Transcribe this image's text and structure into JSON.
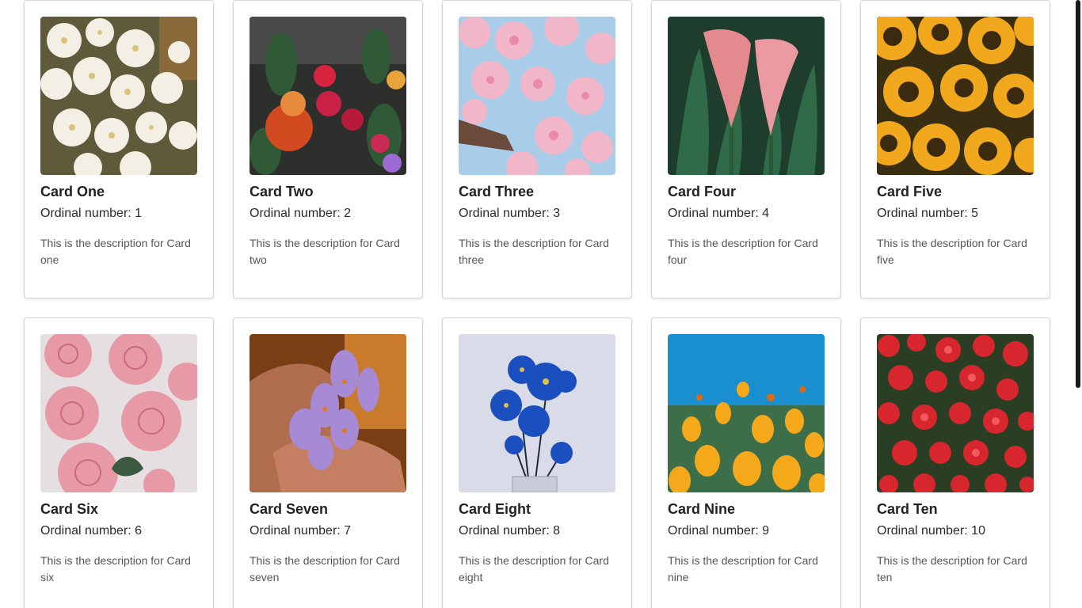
{
  "cards": [
    {
      "title": "Card One",
      "ordinal": "Ordinal number: 1",
      "description": "This is the description for Card one",
      "image_icon": "white-daisy-flowers-image"
    },
    {
      "title": "Card Two",
      "ordinal": "Ordinal number: 2",
      "description": "This is the description for Card two",
      "image_icon": "mixed-bouquet-flowers-image"
    },
    {
      "title": "Card Three",
      "ordinal": "Ordinal number: 3",
      "description": "This is the description for Card three",
      "image_icon": "cherry-blossom-image"
    },
    {
      "title": "Card Four",
      "ordinal": "Ordinal number: 4",
      "description": "This is the description for Card four",
      "image_icon": "calla-lily-image"
    },
    {
      "title": "Card Five",
      "ordinal": "Ordinal number: 5",
      "description": "This is the description for Card five",
      "image_icon": "sunflowers-image"
    },
    {
      "title": "Card Six",
      "ordinal": "Ordinal number: 6",
      "description": "This is the description for Card six",
      "image_icon": "pink-roses-image"
    },
    {
      "title": "Card Seven",
      "ordinal": "Ordinal number: 7",
      "description": "This is the description for Card seven",
      "image_icon": "crocus-in-hand-image"
    },
    {
      "title": "Card Eight",
      "ordinal": "Ordinal number: 8",
      "description": "This is the description for Card eight",
      "image_icon": "blue-daisies-vase-image"
    },
    {
      "title": "Card Nine",
      "ordinal": "Ordinal number: 9",
      "description": "This is the description for Card nine",
      "image_icon": "yellow-poppies-image"
    },
    {
      "title": "Card Ten",
      "ordinal": "Ordinal number: 10",
      "description": "This is the description for Card ten",
      "image_icon": "red-begonias-image"
    }
  ],
  "colors": {
    "card_border": "#d6d6d6",
    "title_text": "#222222",
    "description_text": "#555555",
    "scrollbar_thumb": "#1a1a1a"
  }
}
